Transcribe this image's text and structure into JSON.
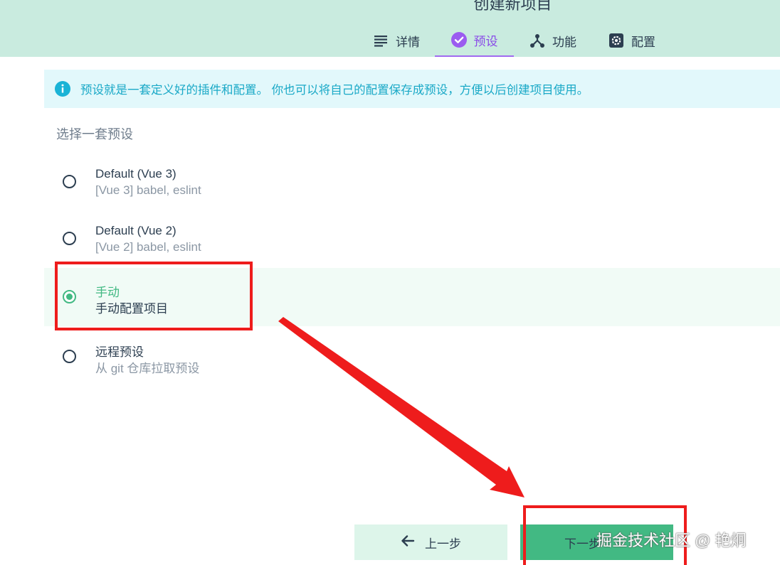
{
  "header": {
    "title": "创建新项目",
    "tabs": [
      {
        "label": "详情",
        "icon": "list-icon"
      },
      {
        "label": "预设",
        "icon": "check-circle-icon",
        "active": true
      },
      {
        "label": "功能",
        "icon": "branch-icon"
      },
      {
        "label": "配置",
        "icon": "gear-icon"
      }
    ]
  },
  "info": {
    "text": "预设就是一套定义好的插件和配置。 你也可以将自己的配置保存成预设，方便以后创建项目使用。",
    "icon": "info-icon"
  },
  "presets": {
    "label": "选择一套预设",
    "options": [
      {
        "name": "Default (Vue 3)",
        "desc": "[Vue 3] babel, eslint",
        "selected": false
      },
      {
        "name": "Default (Vue 2)",
        "desc": "[Vue 2] babel, eslint",
        "selected": false
      },
      {
        "name": "手动",
        "desc": "手动配置项目",
        "selected": true
      },
      {
        "name": "远程预设",
        "desc": "从 git 仓库拉取预设",
        "selected": false
      }
    ]
  },
  "actions": {
    "prev_label": "上一步",
    "next_label": "下一步"
  },
  "watermark": "掘金技术社区 @ 艳炯",
  "colors": {
    "header_bg": "#c9ebdf",
    "accent_purple": "#8a4be8",
    "accent_green": "#42b983",
    "info_bg": "#e2f8fb",
    "info_text": "#1aa9c7",
    "annotation_red": "#ee1c1c"
  }
}
